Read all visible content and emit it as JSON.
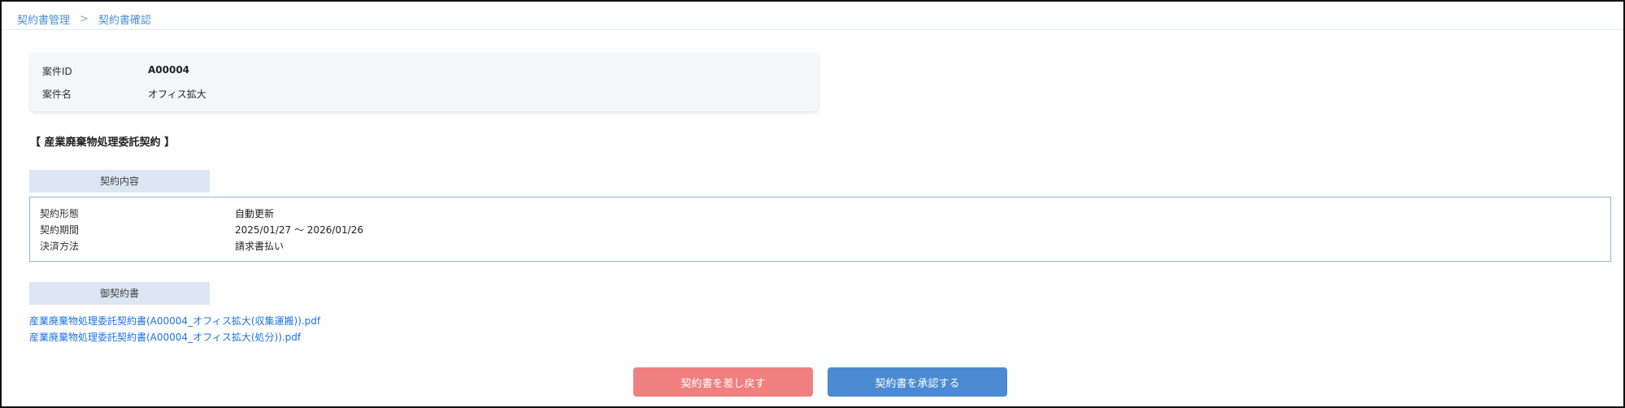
{
  "breadcrumb": {
    "parent": "契約書管理",
    "separator": ">",
    "current": "契約書確認"
  },
  "project": {
    "id_label": "案件ID",
    "id_value": "A00004",
    "name_label": "案件名",
    "name_value": "オフィス拡大"
  },
  "contract_title": "【 産業廃棄物処理委託契約 】",
  "contract_details": {
    "header": "契約内容",
    "rows": [
      {
        "label": "契約形態",
        "value": "自動更新"
      },
      {
        "label": "契約期間",
        "value": "2025/01/27 〜 2026/01/26"
      },
      {
        "label": "決済方法",
        "value": "請求書払い"
      }
    ]
  },
  "documents": {
    "header": "御契約書",
    "files": [
      "産業廃棄物処理委託契約書(A00004_オフィス拡大(収集運搬)).pdf",
      "産業廃棄物処理委託契約書(A00004_オフィス拡大(処分)).pdf"
    ]
  },
  "actions": {
    "return_label": "契約書を差し戻す",
    "approve_label": "契約書を承認する",
    "return_color": "#f07f7f",
    "approve_color": "#4a8bd3"
  }
}
